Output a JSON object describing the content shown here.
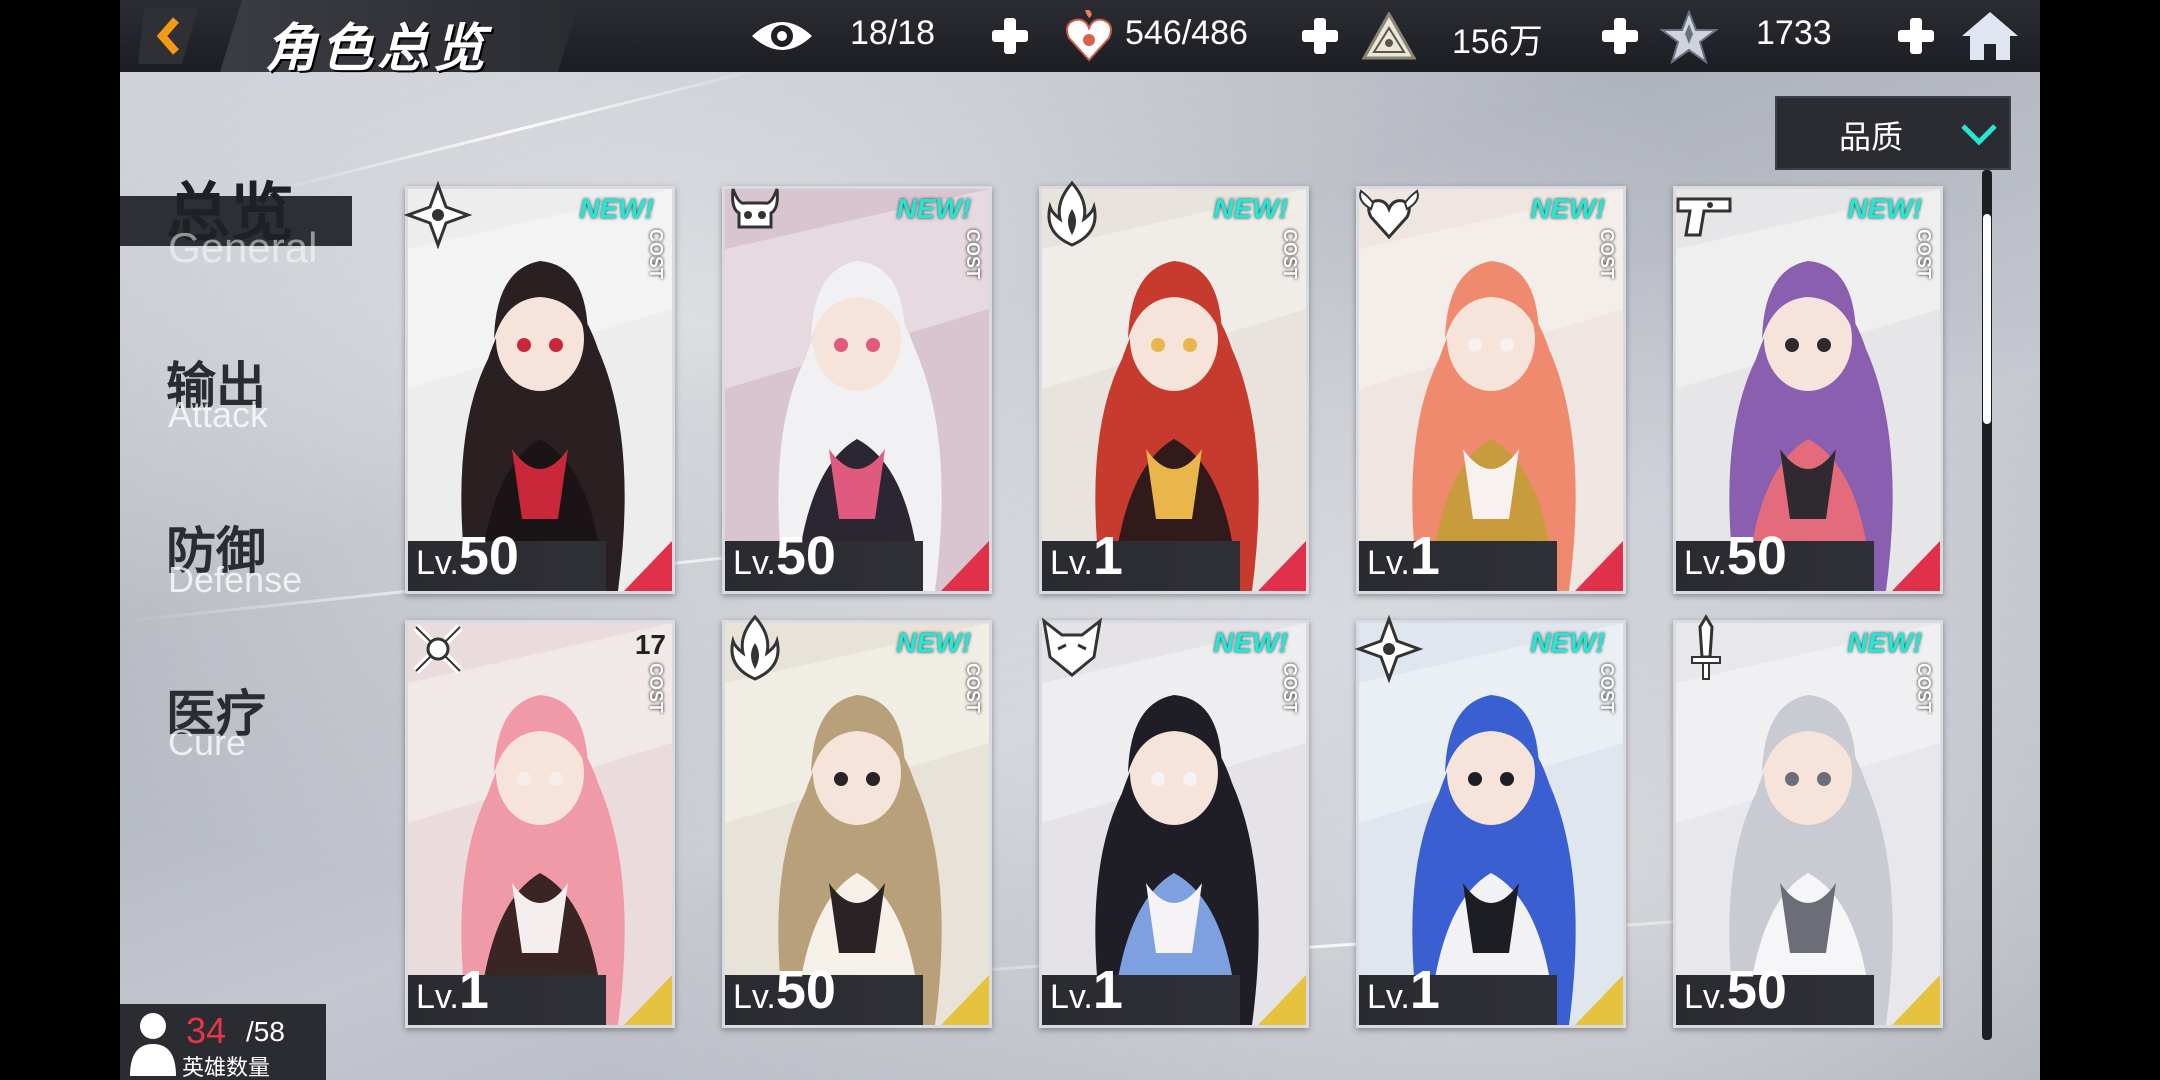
{
  "header": {
    "title": "角色总览",
    "resources": [
      {
        "icon": "eye-icon",
        "value": "18/18"
      },
      {
        "icon": "heart-flame-icon",
        "value": "546/486"
      },
      {
        "icon": "pyramid-icon",
        "value": "156万"
      },
      {
        "icon": "star-crystal-icon",
        "value": "1733"
      }
    ]
  },
  "sort": {
    "label": "品质"
  },
  "tabs": [
    {
      "zh": "总览",
      "en": "General",
      "active": true
    },
    {
      "zh": "输出",
      "en": "Attack",
      "active": false
    },
    {
      "zh": "防御",
      "en": "Defense",
      "active": false
    },
    {
      "zh": "医疗",
      "en": "Cure",
      "active": false
    }
  ],
  "cost_label": "COST",
  "lv_prefix": "Lv.",
  "new_badge": "NEW!",
  "cards": [
    {
      "class_icon": "shuriken-icon",
      "level": "50",
      "new": true,
      "cost_num": "",
      "rarity": "red"
    },
    {
      "class_icon": "horned-skull-icon",
      "level": "50",
      "new": true,
      "cost_num": "",
      "rarity": "red"
    },
    {
      "class_icon": "flame-icon",
      "level": "1",
      "new": true,
      "cost_num": "",
      "rarity": "red"
    },
    {
      "class_icon": "winged-heart-icon",
      "level": "1",
      "new": true,
      "cost_num": "",
      "rarity": "red"
    },
    {
      "class_icon": "pistol-icon",
      "level": "50",
      "new": true,
      "cost_num": "",
      "rarity": "red"
    },
    {
      "class_icon": "crossed-sword-icon",
      "level": "1",
      "new": false,
      "cost_num": "17",
      "rarity": "gold"
    },
    {
      "class_icon": "flame-icon",
      "level": "50",
      "new": true,
      "cost_num": "",
      "rarity": "gold"
    },
    {
      "class_icon": "fox-mask-icon",
      "level": "1",
      "new": true,
      "cost_num": "",
      "rarity": "gold"
    },
    {
      "class_icon": "shuriken-icon",
      "level": "1",
      "new": true,
      "cost_num": "",
      "rarity": "gold"
    },
    {
      "class_icon": "dagger-icon",
      "level": "50",
      "new": true,
      "cost_num": "",
      "rarity": "gold"
    }
  ],
  "hero_count": {
    "current": "34",
    "max": "/58",
    "label": "英雄数量"
  },
  "colors": {
    "accent_orange": "#f29a16",
    "new_cyan": "#25e6d0",
    "rarity_red": "#e0304a",
    "rarity_gold": "#e6c33f"
  }
}
